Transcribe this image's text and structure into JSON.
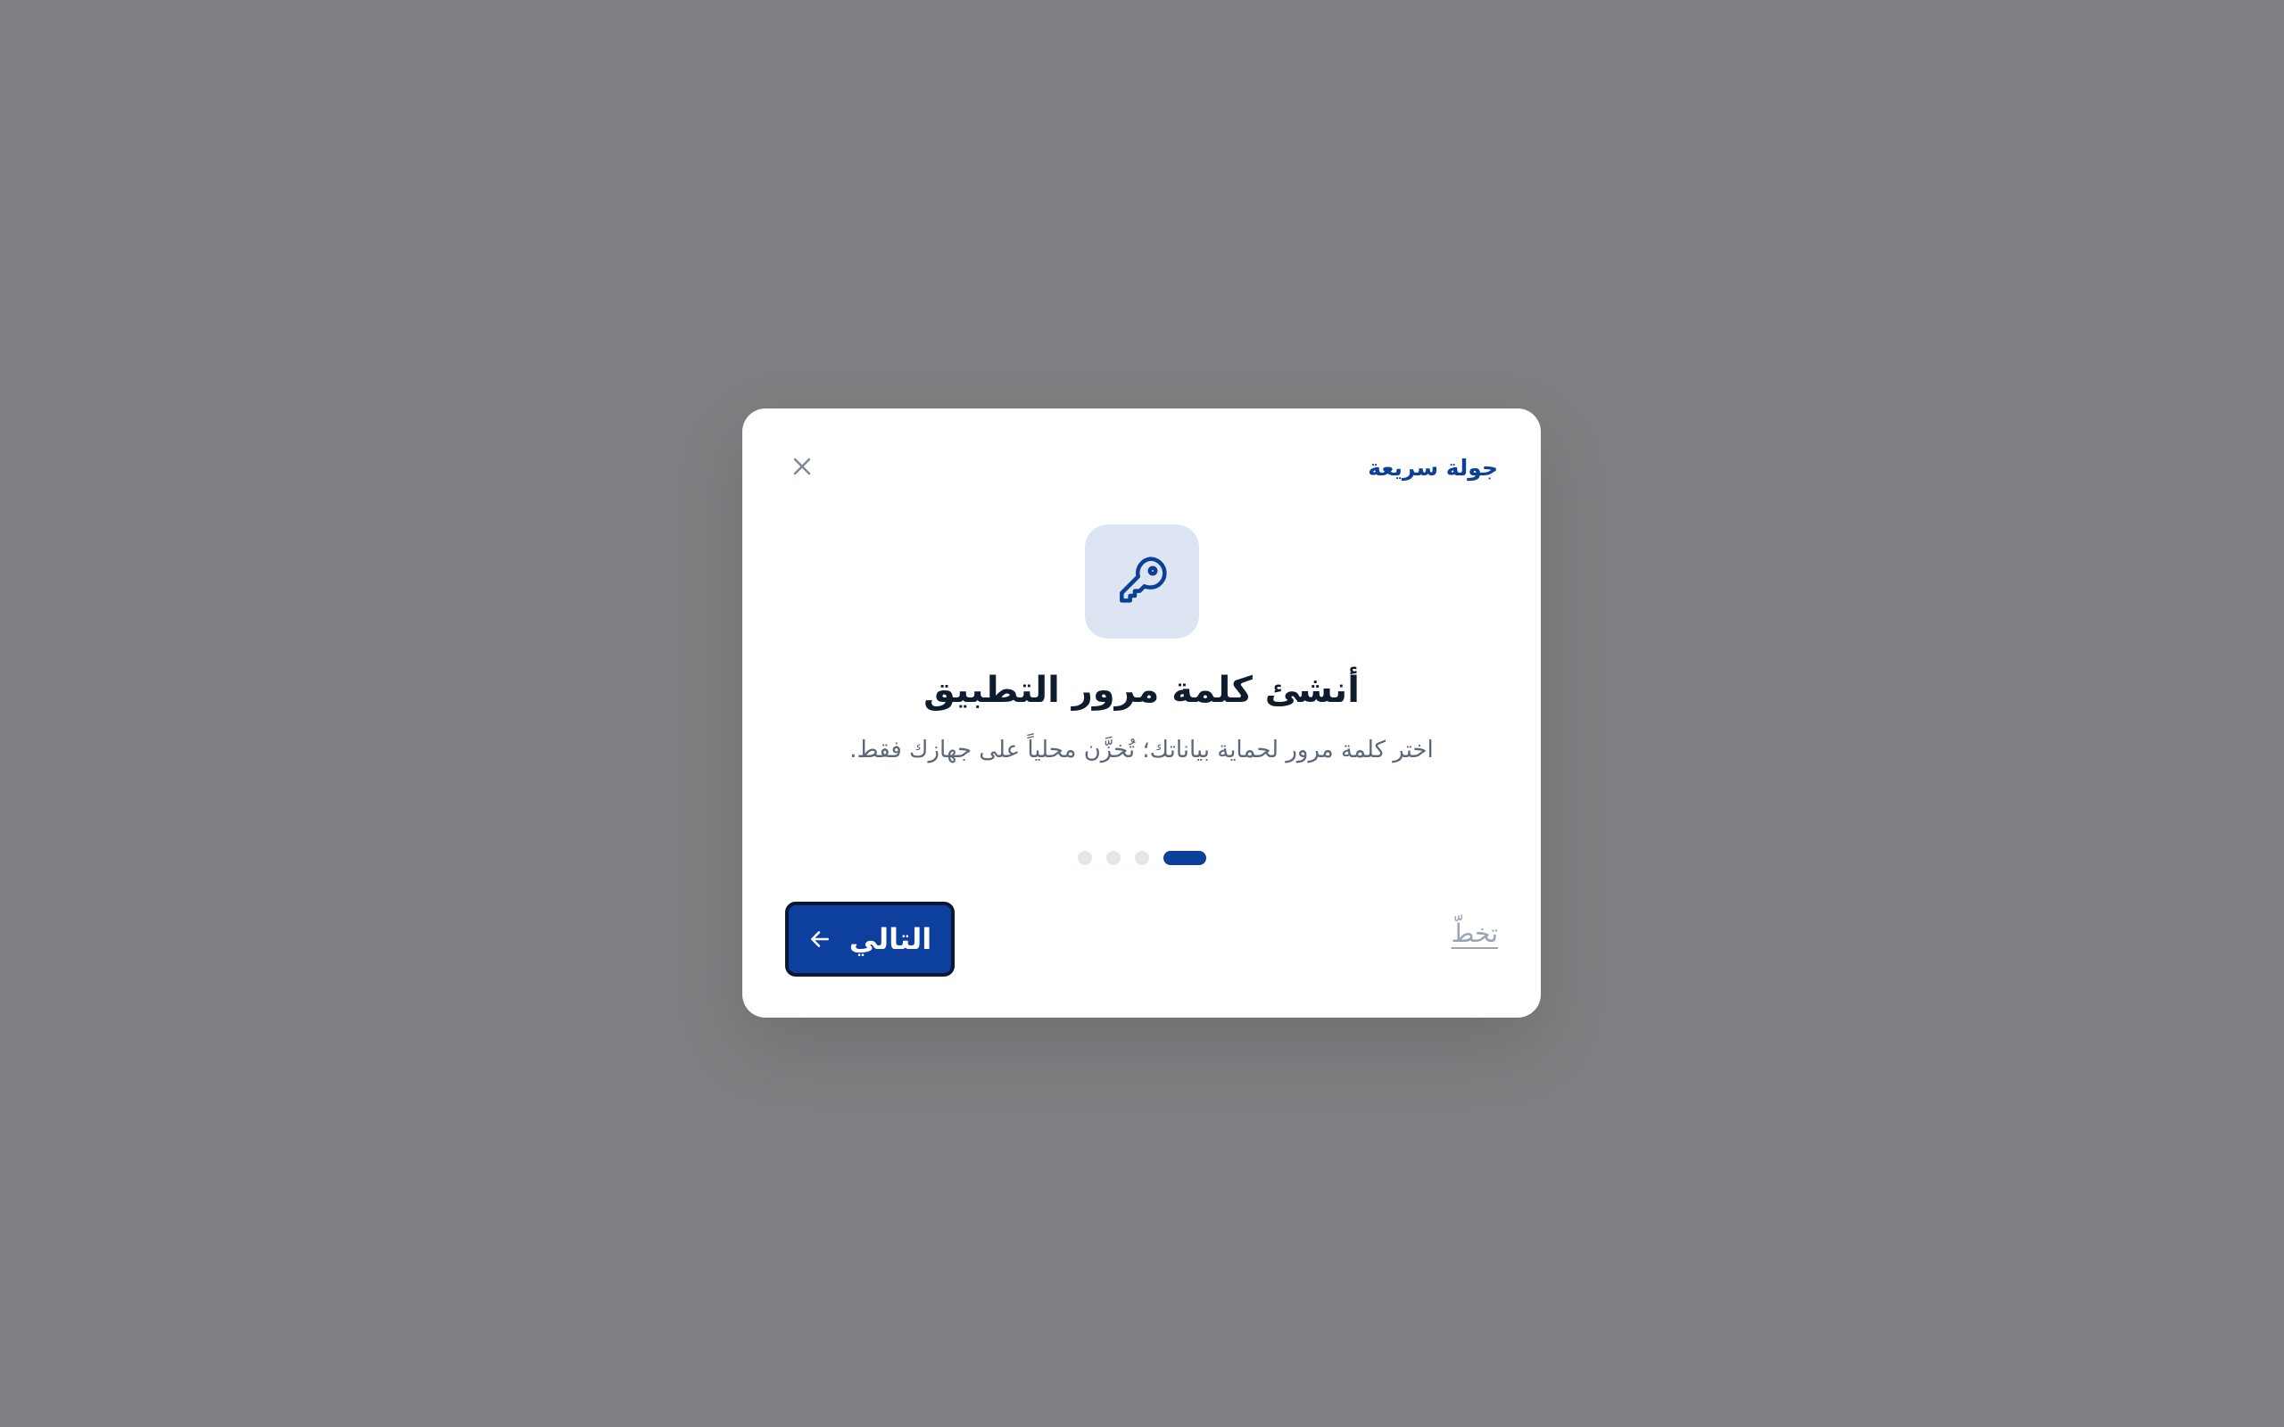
{
  "dialog": {
    "tour_label": "جولة سريعة",
    "title": "أنشئ كلمة مرور التطبيق",
    "subtitle": "اختر كلمة مرور لحماية بياناتك؛ تُخزَّن محلياً على جهازك فقط.",
    "hero_icon": "key-icon",
    "close_icon": "close-icon",
    "steps": {
      "total": 4,
      "current": 1
    },
    "skip_label": "تخطّ",
    "next_label": "التالي",
    "next_icon": "arrow-left-icon"
  },
  "colors": {
    "accent": "#0b3f98",
    "hero_bg": "#dde5f2",
    "backdrop": "#7e7f82",
    "muted_text": "#9aa4b5"
  }
}
